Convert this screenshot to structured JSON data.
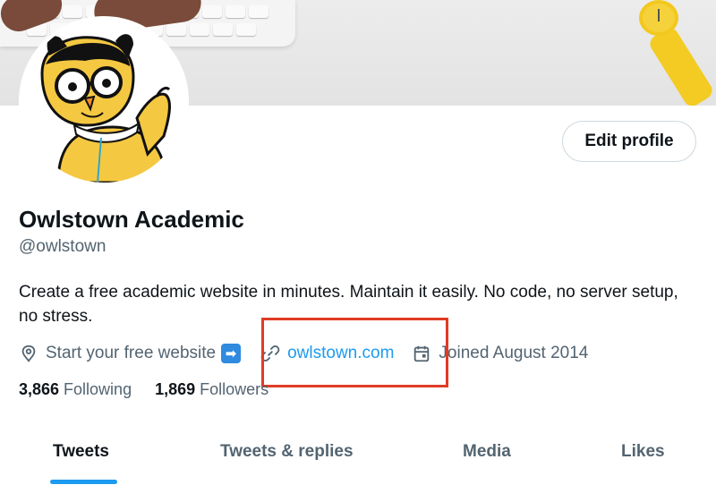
{
  "profile": {
    "display_name": "Owlstown Academic",
    "handle": "@owlstown",
    "bio": "Create a free academic website in minutes. Maintain it easily. No code, no server setup, no stress.",
    "location": "Start your free website",
    "location_emoji": "➡",
    "link": "owlstown.com",
    "joined": "Joined August 2014"
  },
  "actions": {
    "edit_profile": "Edit profile"
  },
  "stats": {
    "following_count": "3,866",
    "following_label": "Following",
    "followers_count": "1,869",
    "followers_label": "Followers"
  },
  "tabs": [
    {
      "label": "Tweets",
      "active": true
    },
    {
      "label": "Tweets & replies",
      "active": false
    },
    {
      "label": "Media",
      "active": false
    },
    {
      "label": "Likes",
      "active": false
    }
  ],
  "colors": {
    "accent": "#1d9bf0",
    "text_primary": "#0f1419",
    "text_secondary": "#536471",
    "highlight_box": "#e03b24",
    "owl_yellow": "#f5c842"
  },
  "icons": {
    "location": "map-pin-icon",
    "link": "link-icon",
    "joined": "calendar-icon"
  }
}
